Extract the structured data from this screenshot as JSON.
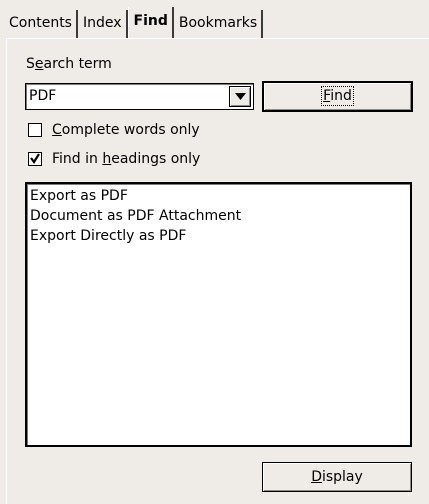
{
  "tabs": [
    {
      "label": "Contents"
    },
    {
      "label": "Index"
    },
    {
      "label": "Find"
    },
    {
      "label": "Bookmarks"
    }
  ],
  "search": {
    "label_pre": "S",
    "label_mnemonic": "e",
    "label_post": "arch term",
    "value": "PDF"
  },
  "find_button": {
    "mnemonic": "F",
    "label_post": "ind"
  },
  "options": {
    "complete_words": {
      "mnemonic": "C",
      "label_post": "omplete words only",
      "checked": false
    },
    "headings_only": {
      "label_pre": "Find in ",
      "mnemonic": "h",
      "label_post": "eadings only",
      "checked": true
    }
  },
  "results": [
    "Export as PDF",
    "Document as PDF Attachment",
    "Export Directly as PDF"
  ],
  "display_button": {
    "mnemonic": "D",
    "label_post": "isplay"
  },
  "icons": {
    "dropdown": "chevron-down-icon",
    "checkmark": "checkmark-icon"
  }
}
